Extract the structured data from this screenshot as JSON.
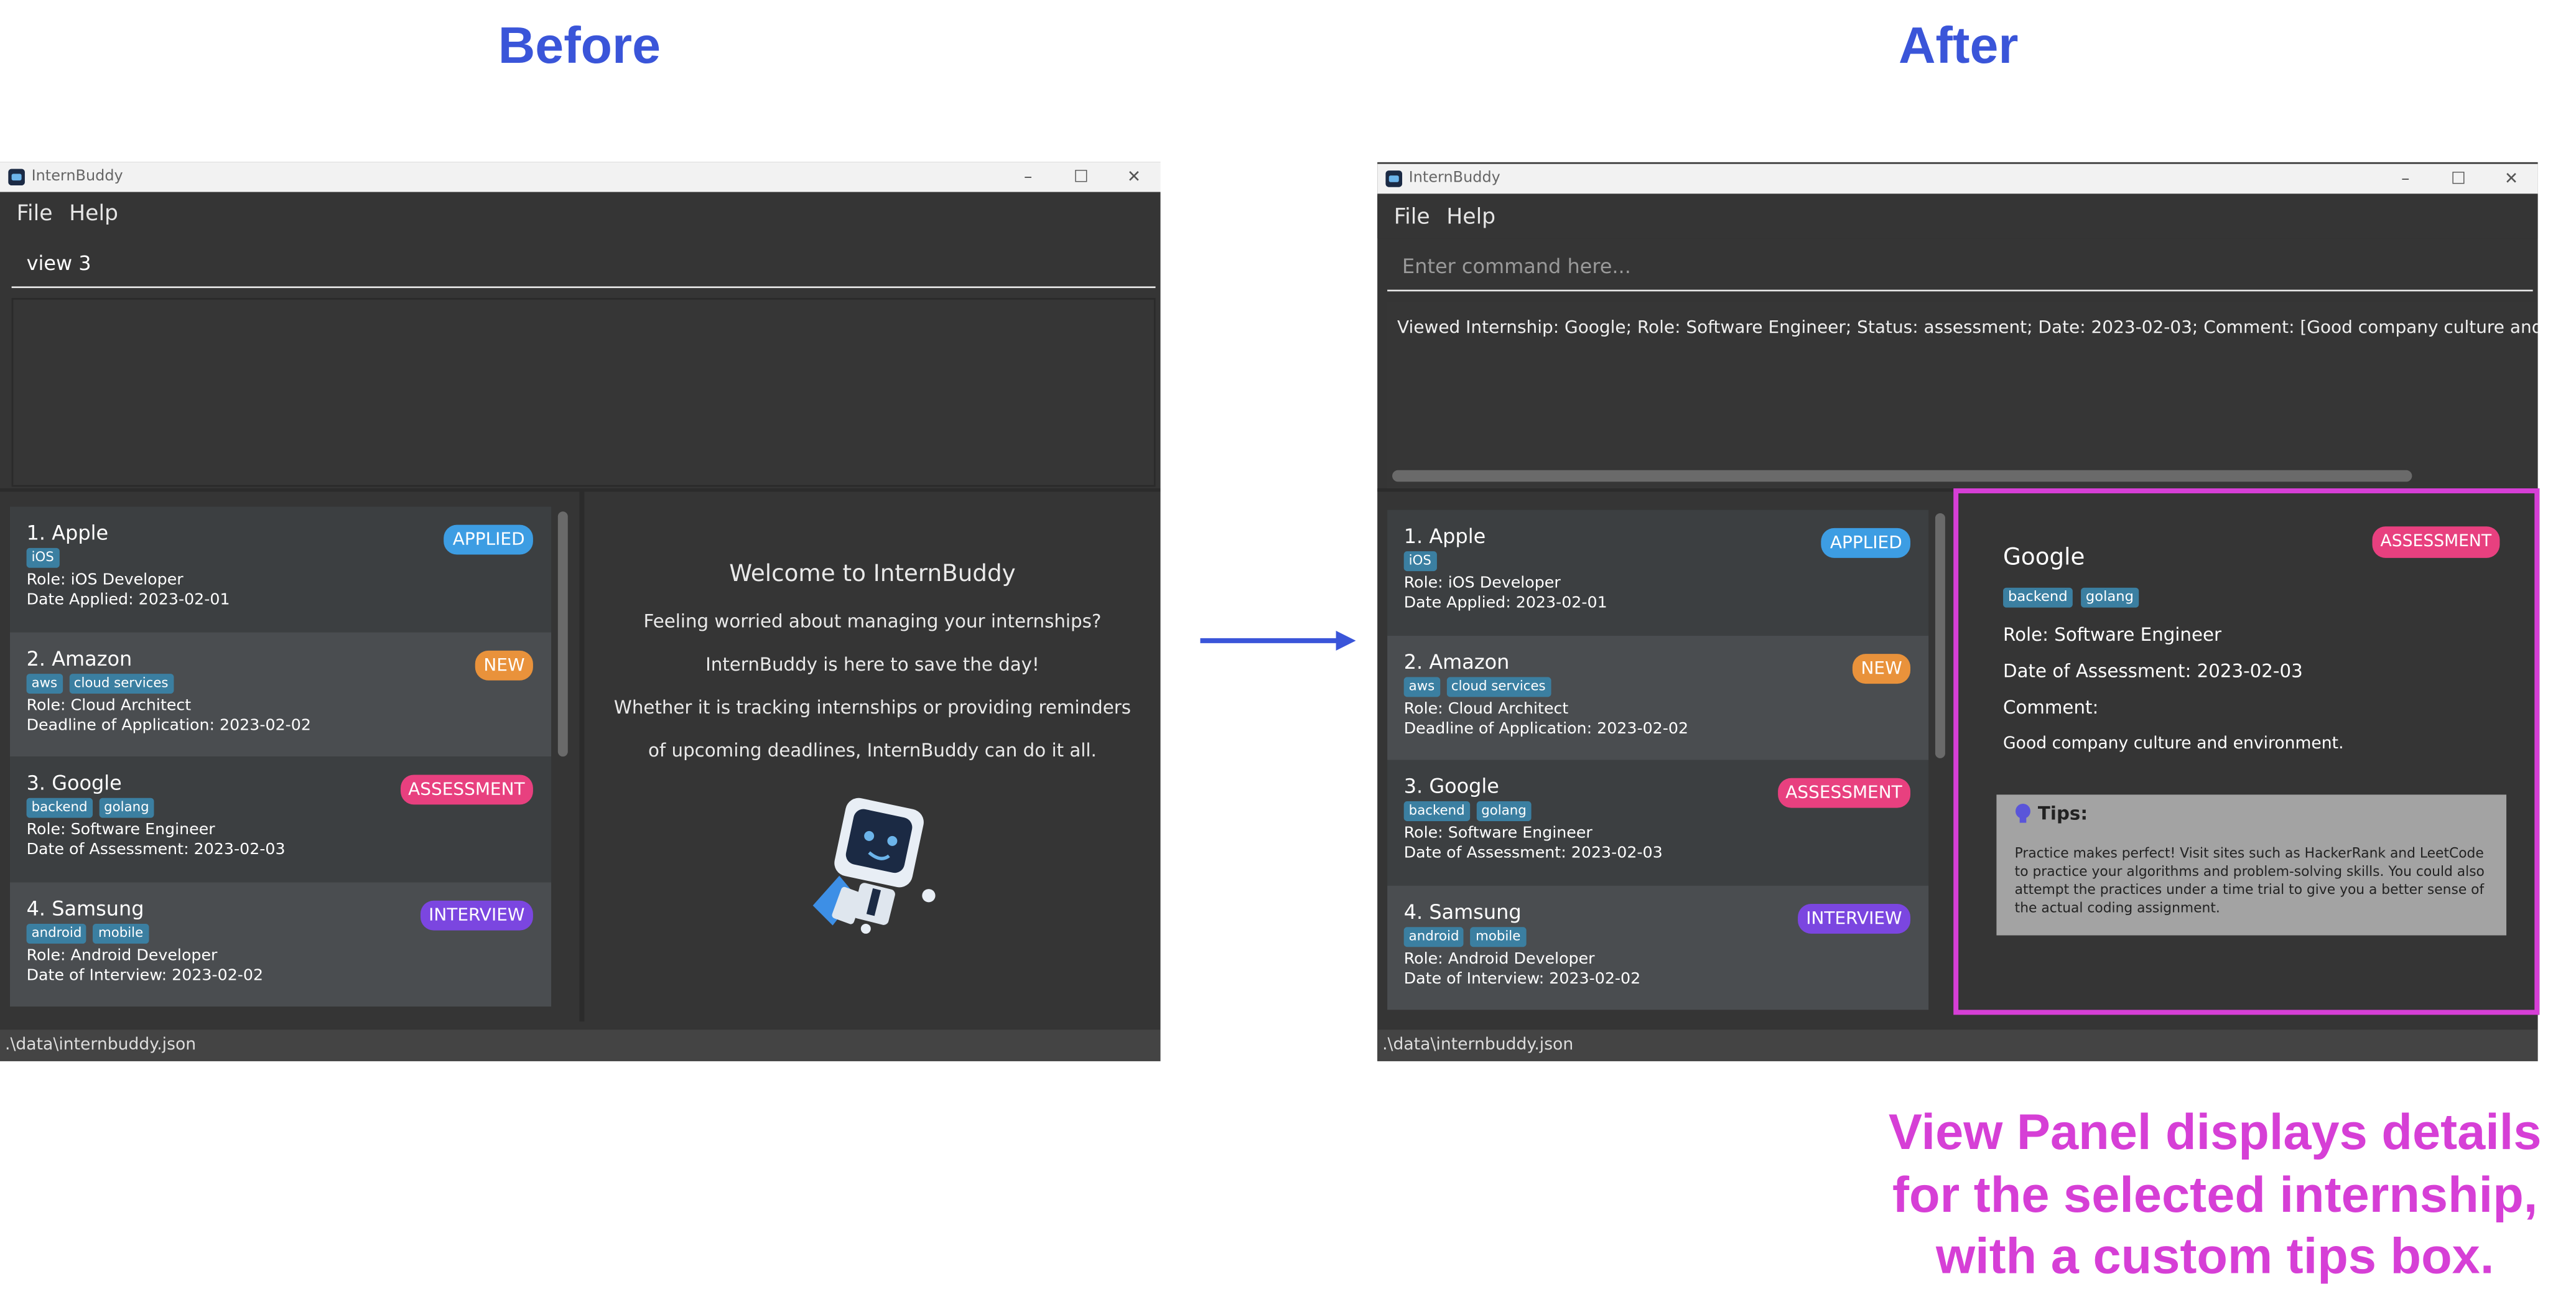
{
  "headings": {
    "before": "Before",
    "after": "After"
  },
  "app": {
    "title": "InternBuddy",
    "menu": [
      "File",
      "Help"
    ],
    "status_path": ".\\data\\internbuddy.json",
    "minimize": "–",
    "maximize": "☐",
    "close": "✕"
  },
  "before": {
    "command_value": "view 3",
    "welcome": {
      "title": "Welcome to InternBuddy",
      "lines": [
        "Feeling worried about managing your internships?",
        "InternBuddy is here to save the day!",
        "Whether it is tracking internships or providing reminders",
        "of upcoming deadlines, InternBuddy can do it all."
      ]
    }
  },
  "after": {
    "command_placeholder": "Enter command here...",
    "result_text": "Viewed Internship: Google; Role: Software Engineer; Status: assessment; Date: 2023-02-03; Comment: [Good company culture and environment.]; Tags: [gc",
    "view_panel": {
      "company": "Google",
      "status": "ASSESSMENT",
      "tags": [
        "backend",
        "golang"
      ],
      "role": "Role: Software Engineer",
      "date": "Date of Assessment: 2023-02-03",
      "comment_label": "Comment:",
      "comment": "Good company culture and environment.",
      "tips_title": "Tips:",
      "tips_body": "Practice makes perfect! Visit sites such as HackerRank and LeetCode to practice your algorithms and problem-solving skills. You could also attempt the practices under a time trial to give you a better sense of the actual coding assignment."
    }
  },
  "internships": [
    {
      "name": "1.  Apple",
      "status": "APPLIED",
      "status_color": "#3d9de3",
      "tags": [
        "iOS"
      ],
      "role": "Role: iOS Developer",
      "date": "Date Applied: 2023-02-01"
    },
    {
      "name": "2.  Amazon",
      "status": "NEW",
      "status_color": "#e9923b",
      "tags": [
        "aws",
        "cloud services"
      ],
      "role": "Role: Cloud Architect",
      "date": "Deadline of Application: 2023-02-02"
    },
    {
      "name": "3.  Google",
      "status": "ASSESSMENT",
      "status_color": "#e8407f",
      "tags": [
        "backend",
        "golang"
      ],
      "role": "Role: Software Engineer",
      "date": "Date of Assessment: 2023-02-03"
    },
    {
      "name": "4.  Samsung",
      "status": "INTERVIEW",
      "status_color": "#7b46e0",
      "tags": [
        "android",
        "mobile"
      ],
      "role": "Role: Android Developer",
      "date": "Date of Interview: 2023-02-02"
    }
  ],
  "caption": {
    "lines": [
      "View Panel displays details",
      "for the selected internship,",
      "with a custom tips box."
    ]
  },
  "colors": {
    "heading": "#3a55d9",
    "highlight": "#d63fd6",
    "arrow": "#3a55d9"
  },
  "icons": {
    "arrow": "right-arrow-icon",
    "app": "app-icon",
    "bulb": "lightbulb-icon"
  }
}
